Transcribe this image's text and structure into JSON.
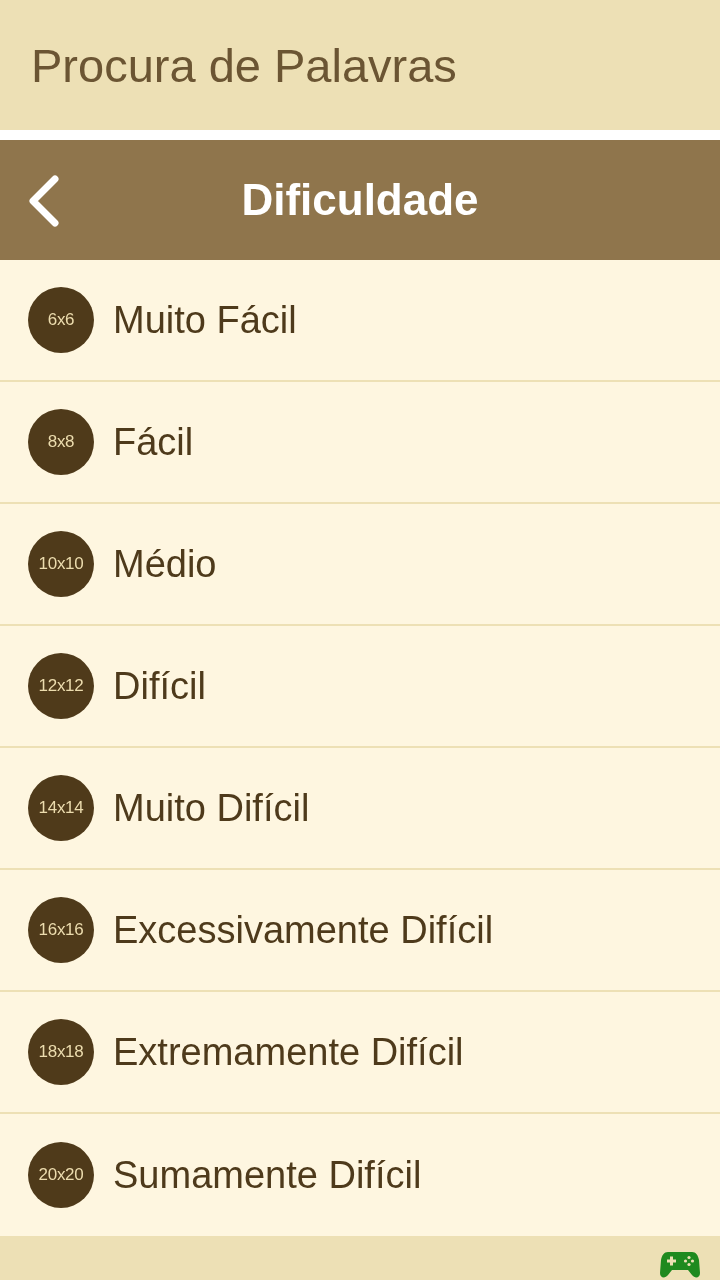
{
  "app_bar": {
    "title": "Procura de Palavras"
  },
  "header": {
    "title": "Dificuldade"
  },
  "levels": [
    {
      "size": "6x6",
      "label": "Muito Fácil"
    },
    {
      "size": "8x8",
      "label": "Fácil"
    },
    {
      "size": "10x10",
      "label": "Médio"
    },
    {
      "size": "12x12",
      "label": "Difícil"
    },
    {
      "size": "14x14",
      "label": "Muito Difícil"
    },
    {
      "size": "16x16",
      "label": "Excessivamente Difícil"
    },
    {
      "size": "18x18",
      "label": "Extremamente Difícil"
    },
    {
      "size": "20x20",
      "label": "Sumamente Difícil"
    }
  ]
}
